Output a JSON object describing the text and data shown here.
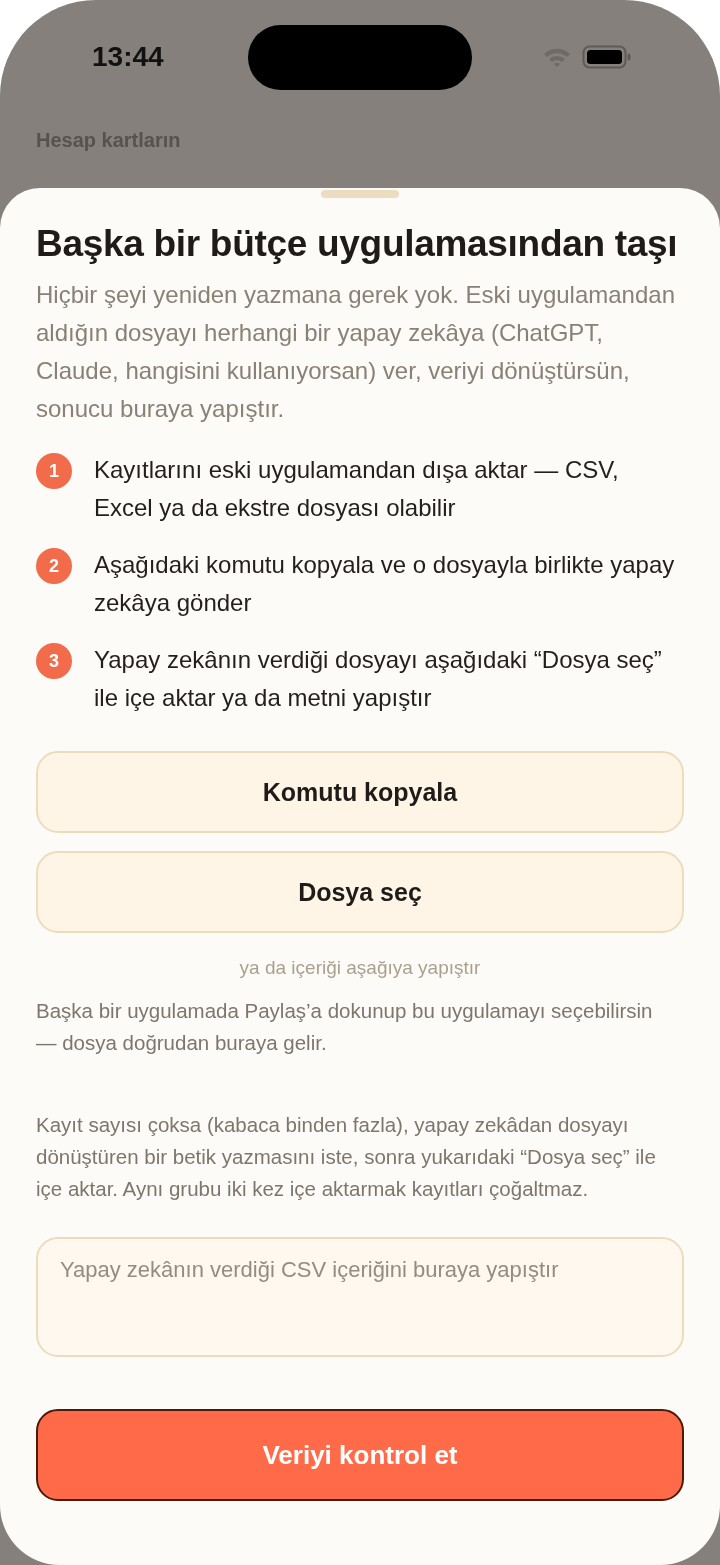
{
  "status_bar": {
    "time": "13:44"
  },
  "background_screen": {
    "subtitle": "Hesap kartların"
  },
  "sheet": {
    "title": "Başka bir bütçe uygulamasından taşı",
    "description": "Hiçbir şeyi yeniden yazmana gerek yok. Eski uygulamandan aldığın dosyayı herhangi bir yapay zekâya (ChatGPT, Claude, hangisini kullanıyorsan) ver, veriyi dönüştürsün, sonucu buraya yapıştır.",
    "steps": [
      {
        "number": "1",
        "text": "Kayıtlarını eski uygulamandan dışa aktar — CSV, Excel ya da ekstre dosyası olabilir"
      },
      {
        "number": "2",
        "text": "Aşağıdaki komutu kopyala ve o dosyayla birlikte yapay zekâya gönder"
      },
      {
        "number": "3",
        "text": "Yapay zekânın verdiği dosyayı aşağıdaki “Dosya seç” ile içe aktar ya da metni yapıştır"
      }
    ],
    "buttons": [
      "Komutu kopyala",
      "Dosya seç"
    ],
    "alternative_hint": "ya da içeriği aşağıya yapıştır",
    "notes": [
      "Başka bir uygulamada Paylaş’a dokunup bu uygulamayı seçebilirsin — dosya doğrudan buraya gelir.",
      "Kayıt sayısı çoksa (kabaca binden fazla), yapay zekâdan dosyayı dönüştüren bir betik yazmasını iste, sonra yukarıdaki “Dosya seç” ile içe aktar. Aynı grubu iki kez içe aktarmak kayıtları çoğaltmaz."
    ],
    "paste_field": {
      "placeholder": "Yapay zekânın verdiği CSV içeriğini buraya yapıştır"
    },
    "primary_button": "Veriyi kontrol et"
  }
}
